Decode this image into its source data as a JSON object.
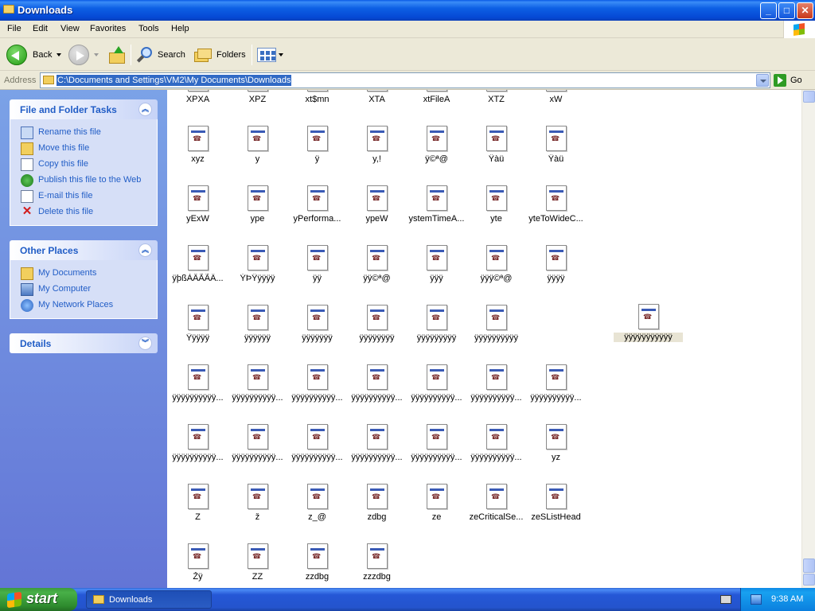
{
  "window": {
    "title": "Downloads",
    "controls": {
      "minimize": "_",
      "maximize": "□",
      "close": "✕"
    }
  },
  "menubar": [
    "File",
    "Edit",
    "View",
    "Favorites",
    "Tools",
    "Help"
  ],
  "toolbar": {
    "back_label": "Back",
    "search_label": "Search",
    "folders_label": "Folders"
  },
  "address": {
    "label": "Address",
    "value": "C:\\Documents and Settings\\VM2\\My Documents\\Downloads",
    "go_label": "Go"
  },
  "sidebar": {
    "file_tasks": {
      "title": "File and Folder Tasks",
      "collapse_glyph": "︽",
      "items": [
        {
          "label": "Rename this file",
          "icon": "rename-icon"
        },
        {
          "label": "Move this file",
          "icon": "move-icon"
        },
        {
          "label": "Copy this file",
          "icon": "copy-icon"
        },
        {
          "label": "Publish this file to the Web",
          "icon": "publish-icon"
        },
        {
          "label": "E-mail this file",
          "icon": "email-icon"
        },
        {
          "label": "Delete this file",
          "icon": "delete-icon"
        }
      ]
    },
    "other_places": {
      "title": "Other Places",
      "collapse_glyph": "︽",
      "items": [
        {
          "label": "My Documents",
          "icon": "my-documents-icon"
        },
        {
          "label": "My Computer",
          "icon": "my-computer-icon"
        },
        {
          "label": "My Network Places",
          "icon": "network-places-icon"
        }
      ]
    },
    "details": {
      "title": "Details",
      "collapse_glyph": "︾"
    }
  },
  "files": {
    "row0": [
      "XPXA",
      "XPZ",
      "xt$mn",
      "XTA",
      "xtFileA",
      "XTZ",
      "xW"
    ],
    "row1": [
      "xyz",
      "y",
      "ÿ",
      "y,!",
      "ÿ©ª@",
      "Ÿàü",
      "Ÿàü"
    ],
    "row2": [
      "yExW",
      "ype",
      "yPerforma...",
      "ypeW",
      "ystemTimeA...",
      "yte",
      "yteToWideC..."
    ],
    "row3": [
      "ÿþßÀÂÃÃÄ...",
      "ÝÞŸÿÿÿÿ",
      "ÿÿ",
      "ÿÿ©ª@",
      "ÿÿÿ",
      "ÿÿÿ©ª@",
      "ÿÿÿÿ"
    ],
    "row4": [
      "Ÿÿÿÿÿ",
      "ÿÿÿÿÿÿ",
      "ÿÿÿÿÿÿÿ",
      "ÿÿÿÿÿÿÿÿ",
      "ÿÿÿÿÿÿÿÿÿ",
      "ÿÿÿÿÿÿÿÿÿÿ"
    ],
    "row4_selected": "ÿÿÿÿÿÿÿÿÿÿÿ",
    "row5": [
      "ÿÿÿÿÿÿÿÿÿÿ...",
      "ÿÿÿÿÿÿÿÿÿÿ...",
      "ÿÿÿÿÿÿÿÿÿÿ...",
      "ÿÿÿÿÿÿÿÿÿÿ...",
      "ÿÿÿÿÿÿÿÿÿÿ...",
      "ÿÿÿÿÿÿÿÿÿÿ...",
      "ÿÿÿÿÿÿÿÿÿÿ..."
    ],
    "row6": [
      "ÿÿÿÿÿÿÿÿÿÿ...",
      "ÿÿÿÿÿÿÿÿÿÿ...",
      "ÿÿÿÿÿÿÿÿÿÿ...",
      "ÿÿÿÿÿÿÿÿÿÿ...",
      "ÿÿÿÿÿÿÿÿÿÿ...",
      "ÿÿÿÿÿÿÿÿÿÿ...",
      "yz"
    ],
    "row7": [
      "Z",
      "ž",
      "z_@",
      "zdbg",
      "ze",
      "zeCriticalSe...",
      "zeSListHead"
    ],
    "row8": [
      "Žÿ",
      "ZZ",
      "zzdbg",
      "zzzdbg"
    ]
  },
  "taskbar": {
    "start_label": "start",
    "task_label": "Downloads",
    "clock": "9:38 AM"
  }
}
